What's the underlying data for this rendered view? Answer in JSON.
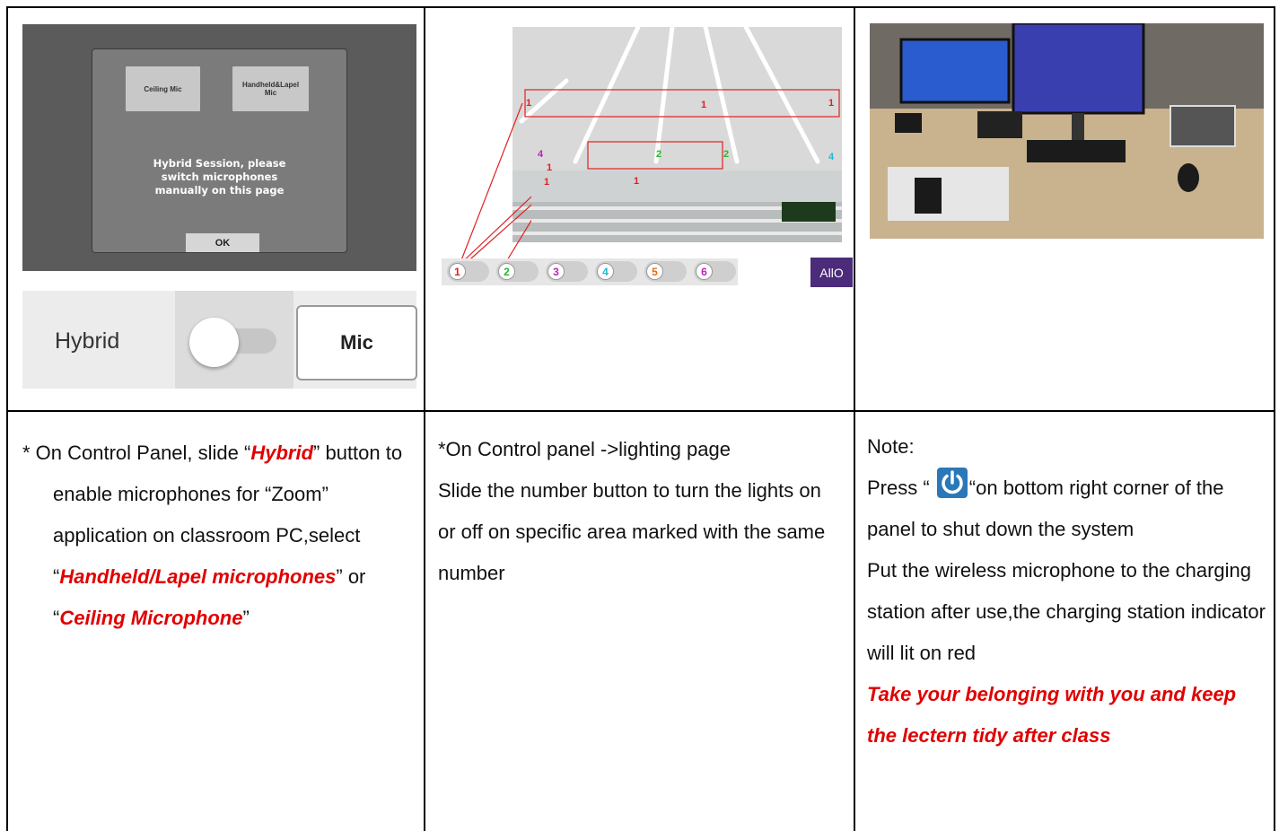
{
  "dialog": {
    "btn_ceiling": "Ceiling Mic",
    "btn_handheld": "Handheld&Lapel\nMic",
    "message": "Hybrid Session, please\nswitch microphones\nmanually on this page",
    "ok": "OK"
  },
  "hybrid_strip": {
    "label": "Hybrid",
    "mic_button": "Mic"
  },
  "lighting": {
    "zones": [
      "1",
      "2",
      "3",
      "4",
      "5",
      "6"
    ],
    "zone_colors": [
      "#e02020",
      "#2bb52b",
      "#c020c0",
      "#20b8d8",
      "#e86a10",
      "#c020c0"
    ],
    "room_labels": [
      "1",
      "1",
      "1",
      "1",
      "1",
      "1",
      "2",
      "2",
      "4",
      "4"
    ],
    "all_button": "AllO"
  },
  "instructions": {
    "col1": {
      "prefix": "* On Control Panel, slide “",
      "hybrid": "Hybrid",
      "part2": "” button to enable microphones for “Zoom” application on classroom PC,select “",
      "handheld": "Handheld/Lapel microphones",
      "part3": "” or “",
      "ceiling": "Ceiling Microphone",
      "part4": "”"
    },
    "col2": {
      "line1": "*On Control panel ->lighting page",
      "line2": "Slide the number button to turn the lights on or off  on specific area marked with the same number"
    },
    "col3": {
      "note": "Note:",
      "press_before": "Press “ ",
      "press_after": "“on bottom right corner of the panel to shut down the system",
      "charging": "Put the wireless microphone to the charging station after use,the charging station indicator will lit on red",
      "reminder": "Take your belonging with you and keep the lectern tidy after class"
    }
  },
  "colors": {
    "accent_red": "#e00000",
    "power_blue": "#2a78b8",
    "all_button_purple": "#4b2b7a"
  }
}
